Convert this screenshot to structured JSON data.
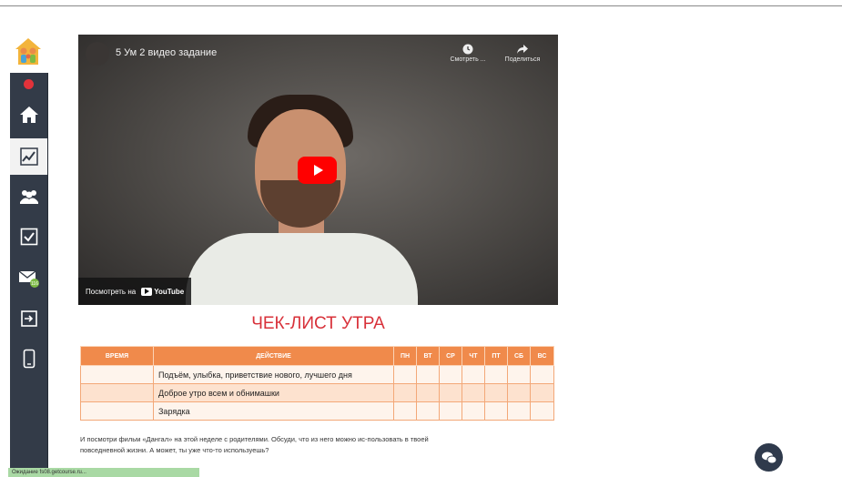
{
  "video": {
    "title": "5 Ум 2 видео задание",
    "watch_later_label": "Смотреть ...",
    "share_label": "Поделиться",
    "watch_on_label": "Посмотреть на",
    "youtube_brand": "YouTube"
  },
  "checklist": {
    "title": "ЧЕК-ЛИСТ УТРА",
    "headers": {
      "time": "ВРЕМЯ",
      "action": "ДЕЙСТВИЕ",
      "days": [
        "ПН",
        "ВТ",
        "СР",
        "ЧТ",
        "ПТ",
        "СБ",
        "ВС"
      ]
    },
    "rows": [
      {
        "time": "",
        "action": "Подъём, улыбка, приветствие нового, лучшего дня"
      },
      {
        "time": "",
        "action": "Доброе утро всем и обнимашки"
      },
      {
        "time": "",
        "action": "Зарядка"
      }
    ]
  },
  "description": "И посмотри фильм «Дангал» на этой неделе с родителями. Обсуди, что из него можно ис-пользовать в твоей повседневной жизни. А может, ты уже что-то используешь?",
  "sidebar": {
    "items": [
      {
        "icon": "home-icon"
      },
      {
        "icon": "chart-icon"
      },
      {
        "icon": "group-icon"
      },
      {
        "icon": "checkbox-icon"
      },
      {
        "icon": "mail-icon",
        "badge": "116"
      },
      {
        "icon": "login-icon"
      },
      {
        "icon": "phone-icon"
      }
    ]
  },
  "status_bar": {
    "text": "Ожидание fs08.getcourse.ru..."
  },
  "colors": {
    "sidebar": "#333b48",
    "accent_red": "#d8313a",
    "table_header": "#f08a4b",
    "youtube_red": "#ff0000",
    "chat_button": "#2f3a4c"
  }
}
